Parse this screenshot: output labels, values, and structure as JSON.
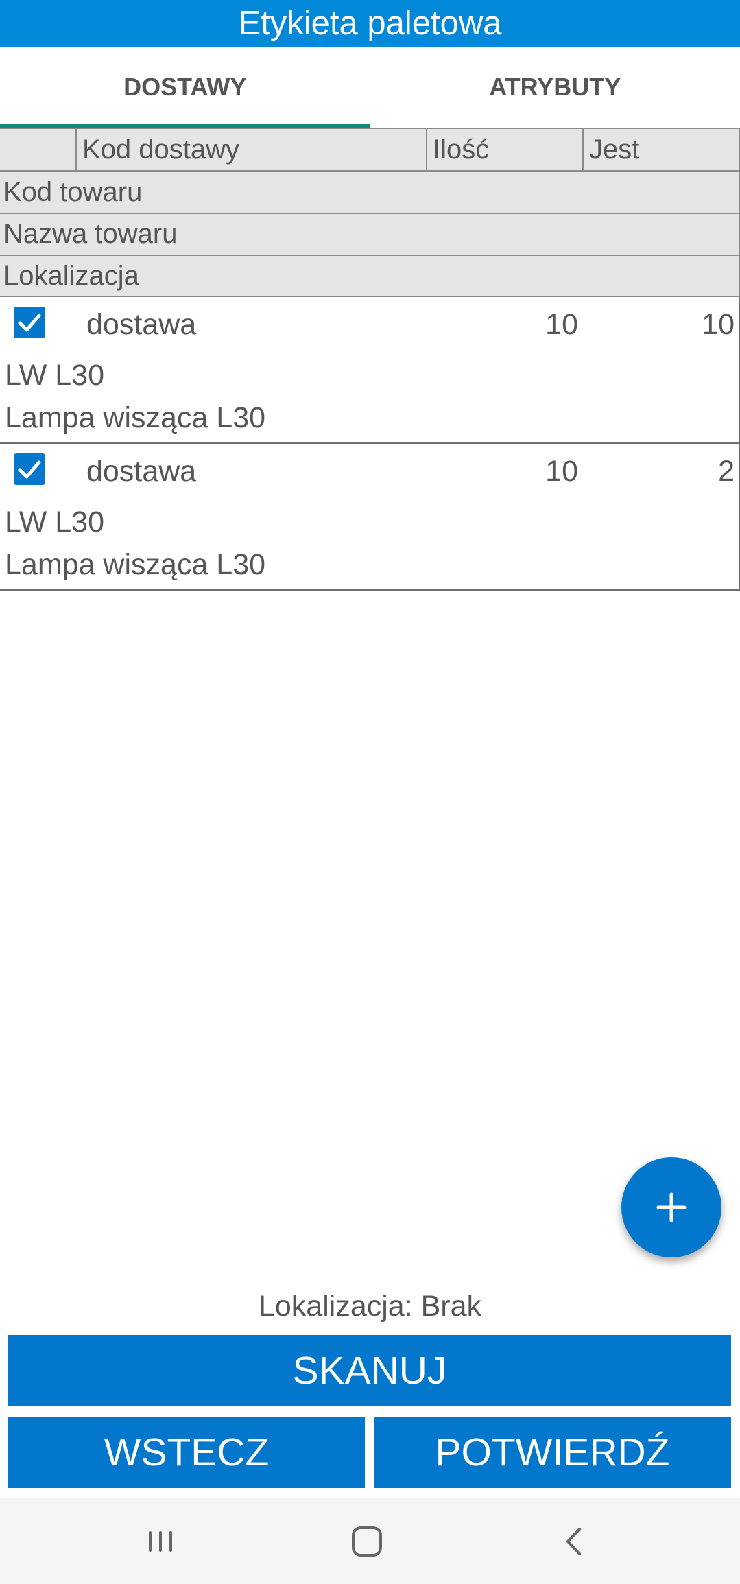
{
  "title": "Etykieta paletowa",
  "tabs": [
    {
      "label": "DOSTAWY",
      "active": true
    },
    {
      "label": "ATRYBUTY",
      "active": false
    }
  ],
  "table_header": {
    "row1": [
      "",
      "Kod dostawy",
      "Ilość",
      "Jest"
    ],
    "row2": "Kod towaru",
    "row3": "Nazwa towaru",
    "row4": "Lokalizacja"
  },
  "items": [
    {
      "checked": true,
      "delivery": "dostawa",
      "qty": "10",
      "jest": "10",
      "code": "LW L30",
      "name": "Lampa wisząca L30"
    },
    {
      "checked": true,
      "delivery": "dostawa",
      "qty": "10",
      "jest": "2",
      "code": "LW L30",
      "name": "Lampa wisząca L30"
    }
  ],
  "location_status": "Lokalizacja: Brak",
  "buttons": {
    "scan": "SKANUJ",
    "back": "WSTECZ",
    "confirm": "POTWIERDŹ"
  },
  "icons": {
    "fab": "plus-icon",
    "checkbox": "checkmark-icon",
    "nav": [
      "recents-icon",
      "home-icon",
      "back-icon"
    ]
  },
  "colors": {
    "primary": "#0277cc",
    "title_bar": "#0288d8",
    "tab_indicator": "#0f8a7a",
    "header_bg": "#e5e5e5"
  }
}
